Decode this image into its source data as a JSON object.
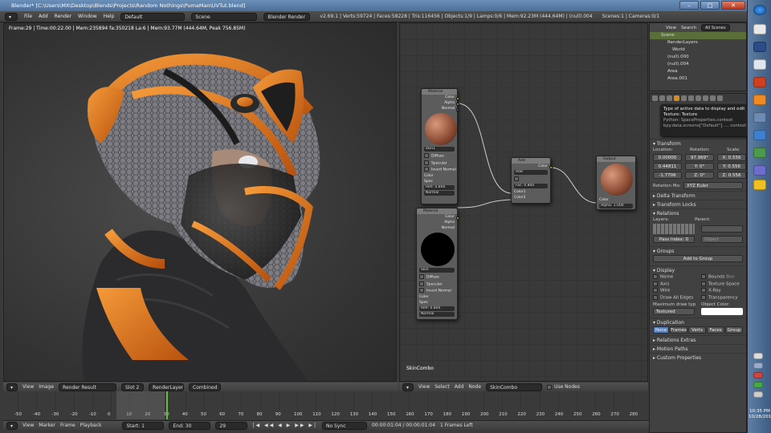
{
  "window": {
    "title": "Blender* [C:\\Users\\MX\\Desktop\\Blends\\Projects\\Random Nothings\\PumaMan\\UVTut.blend]"
  },
  "info_header": {
    "menus": [
      "File",
      "Add",
      "Render",
      "Window",
      "Help"
    ],
    "screen_layout": "Default",
    "scene": "Scene",
    "render_engine": "Blender Render",
    "stats": "v2.69.1 | Verts:59724 | Faces:58228 | Tris:116456 | Objects:1/9 | Lamps:0/6 | Mem:92.23M (444.64M) | (null).004",
    "scenes_cameras": "Scenes:1 | Cameras:0/1"
  },
  "viewport": {
    "render_stats": "Frame:29 | Time:00:22.00 | Mem:235894 fa:350218 La:6 | Mem:93.77M (444.64M, Peak 756.85M)"
  },
  "node_editor": {
    "material_name": "SkinCombo",
    "nodes": {
      "mat1": {
        "title": "Material",
        "outputs": [
          "Color",
          "Alpha",
          "Normal"
        ],
        "name": "skin1",
        "options": [
          "Diffuse",
          "Specular",
          "Invert Normal"
        ],
        "inputs": [
          "Color",
          "Spec",
          "Refl: 0.800",
          "Normal"
        ]
      },
      "mat2": {
        "title": "Material",
        "outputs": [
          "Color",
          "Alpha",
          "Normal"
        ],
        "name": "Skin",
        "options": [
          "Diffuse",
          "Specular",
          "Invert Normal"
        ],
        "inputs": [
          "Color",
          "Spec",
          "Refl: 0.800",
          "Normal"
        ]
      },
      "mix": {
        "title": "Add",
        "output": "Color",
        "blend": "Add",
        "fac": "Fac: 0.800",
        "inputs": [
          "Color1",
          "Color2"
        ]
      },
      "out": {
        "title": "Output",
        "inputs": [
          "Color",
          "Alpha: 1.000"
        ]
      }
    },
    "header_menus": [
      "View",
      "Select",
      "Add",
      "Node"
    ],
    "use_nodes": "Use Nodes"
  },
  "outliner": {
    "header": [
      "View",
      "Search",
      "All Scenes"
    ],
    "rows": [
      "Scene",
      "RenderLayers",
      "World",
      "(null).000",
      "(null).004",
      "Area",
      "Area.001"
    ]
  },
  "properties": {
    "tooltip": {
      "line1": "Type of active data to display and edit",
      "line2": "Texture: Texture",
      "line3": "Python: SpaceProperties.context",
      "line4": "bpy.data.screens[\"Default\"]. ... context"
    },
    "transform": {
      "title": "Transform",
      "location_label": "Location:",
      "rotation_label": "Rotation:",
      "scale_label": "Scale:",
      "location": [
        "0.00000",
        "0.44811",
        "-1.7706"
      ],
      "rotation": [
        "97.969°",
        "Y: 0°",
        "Z: 0°"
      ],
      "scale": [
        "X: 0.556",
        "Y: 0.556",
        "Z: 0.556"
      ],
      "rotation_mode_label": "Rotation Mo:",
      "rotation_mode": "XYZ Euler"
    },
    "panels": {
      "delta": "Delta Transform",
      "locks": "Transform Locks",
      "relations": "Relations",
      "groups": "Groups",
      "display": "Display",
      "duplication": "Duplication",
      "relations_extras": "Relations Extras",
      "motion_paths": "Motion Paths",
      "custom": "Custom Properties"
    },
    "relations": {
      "layers": "Layers:",
      "parent": "Parent:",
      "object": "Object",
      "pass_index": "Pass Index: 0"
    },
    "groups": {
      "add": "Add to Group"
    },
    "display": {
      "left": [
        "Name",
        "Axis",
        "Wire",
        "Draw All Edges"
      ],
      "right": [
        "Bounds",
        "Texture Space",
        "X-Ray",
        "Transparency"
      ],
      "bounds_type": "Box",
      "max_draw_label": "Maximum draw typ",
      "max_draw": "Textured",
      "object_color_label": "Object Color:"
    },
    "duplication_tabs": [
      "None",
      "Frames",
      "Verts",
      "Faces",
      "Group"
    ]
  },
  "timeline": {
    "header_menus": [
      "View",
      "Image"
    ],
    "image_name": "Render Result",
    "slot": "Slot 2",
    "layer": "RenderLayer",
    "pass": "Combined",
    "ticks": [
      "-50",
      "-40",
      "-30",
      "-20",
      "-10",
      "0",
      "10",
      "20",
      "30",
      "40",
      "50",
      "60",
      "70",
      "80",
      "90",
      "100",
      "110",
      "120",
      "130",
      "140",
      "150",
      "160",
      "170",
      "180",
      "190",
      "200",
      "210",
      "220",
      "230",
      "240",
      "250",
      "260",
      "270",
      "280"
    ],
    "bottom_menus": [
      "View",
      "Marker",
      "Frame",
      "Playback"
    ],
    "start": "Start: 1",
    "end": "End: 30",
    "current": "29",
    "sync": "No Sync",
    "time_readout": "00:00:01:04 / 00:00:01:04",
    "frames_left": "1 Frames Left"
  },
  "taskbar": {
    "time": "10:35 PM",
    "date": "10/28/2013"
  }
}
